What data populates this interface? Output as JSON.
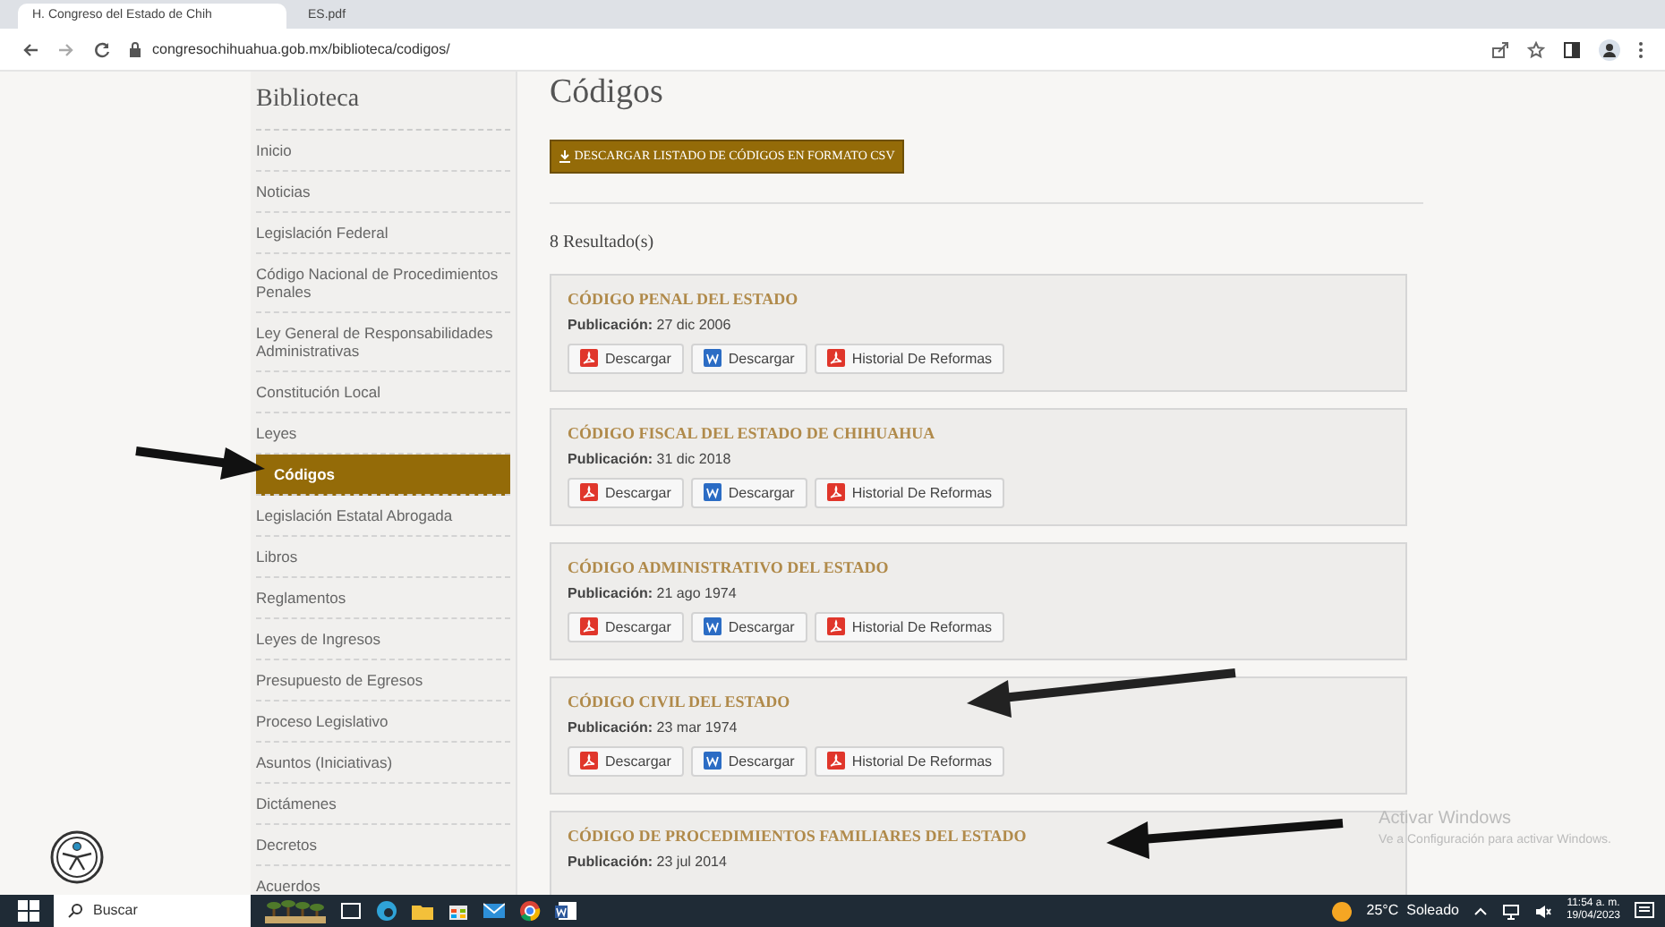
{
  "browser": {
    "tabs": [
      {
        "title": "H. Congreso del Estado de Chih",
        "selected": true
      },
      {
        "title": "ES.pdf",
        "selected": false
      }
    ],
    "url": "congresochihuahua.gob.mx/biblioteca/codigos/"
  },
  "sidebar": {
    "title": "Biblioteca",
    "items": [
      {
        "label": "Inicio",
        "selected": false
      },
      {
        "label": "Noticias",
        "selected": false
      },
      {
        "label": "Legislación Federal",
        "selected": false
      },
      {
        "label": "Código Nacional de Procedimientos Penales",
        "selected": false
      },
      {
        "label": "Ley General de Responsabilidades Administrativas",
        "selected": false
      },
      {
        "label": "Constitución Local",
        "selected": false
      },
      {
        "label": "Leyes",
        "selected": false
      },
      {
        "label": "Códigos",
        "selected": true
      },
      {
        "label": "Legislación Estatal Abrogada",
        "selected": false
      },
      {
        "label": "Libros",
        "selected": false
      },
      {
        "label": "Reglamentos",
        "selected": false
      },
      {
        "label": "Leyes de Ingresos",
        "selected": false
      },
      {
        "label": "Presupuesto de Egresos",
        "selected": false
      },
      {
        "label": "Proceso Legislativo",
        "selected": false
      },
      {
        "label": "Asuntos (Iniciativas)",
        "selected": false
      },
      {
        "label": "Dictámenes",
        "selected": false
      },
      {
        "label": "Decretos",
        "selected": false
      },
      {
        "label": "Acuerdos",
        "selected": false
      }
    ]
  },
  "main": {
    "title": "Códigos",
    "download_button": "DESCARGAR LISTADO DE CÓDIGOS EN FORMATO CSV",
    "results": "8 Resultado(s)",
    "codes": [
      {
        "title": "CÓDIGO PENAL DEL ESTADO",
        "date_label": "Publicación:",
        "date": "27 dic 2006",
        "buttons": [
          {
            "kind": "pdf",
            "label": "Descargar"
          },
          {
            "kind": "word",
            "label": "Descargar"
          },
          {
            "kind": "pdf",
            "label": "Historial De Reformas"
          }
        ]
      },
      {
        "title": "CÓDIGO FISCAL DEL ESTADO DE CHIHUAHUA",
        "date_label": "Publicación:",
        "date": "31 dic 2018",
        "buttons": [
          {
            "kind": "pdf",
            "label": "Descargar"
          },
          {
            "kind": "word",
            "label": "Descargar"
          },
          {
            "kind": "pdf",
            "label": "Historial De Reformas"
          }
        ]
      },
      {
        "title": "CÓDIGO ADMINISTRATIVO DEL ESTADO",
        "date_label": "Publicación:",
        "date": "21 ago 1974",
        "buttons": [
          {
            "kind": "pdf",
            "label": "Descargar"
          },
          {
            "kind": "word",
            "label": "Descargar"
          },
          {
            "kind": "pdf",
            "label": "Historial De Reformas"
          }
        ]
      },
      {
        "title": "CÓDIGO CIVIL DEL ESTADO",
        "date_label": "Publicación:",
        "date": "23 mar 1974",
        "buttons": [
          {
            "kind": "pdf",
            "label": "Descargar"
          },
          {
            "kind": "word",
            "label": "Descargar"
          },
          {
            "kind": "pdf",
            "label": "Historial De Reformas"
          }
        ]
      },
      {
        "title": "CÓDIGO DE PROCEDIMIENTOS FAMILIARES DEL ESTADO",
        "date_label": "Publicación:",
        "date": "23 jul 2014"
      }
    ]
  },
  "windows_notice": {
    "title": "Activar Windows",
    "text": "Ve a Configuración para activar Windows."
  },
  "taskbar": {
    "search": "Buscar",
    "weather": "25°C  Soleado",
    "time": "11:54 a. m.",
    "date": "19/04/2023"
  }
}
